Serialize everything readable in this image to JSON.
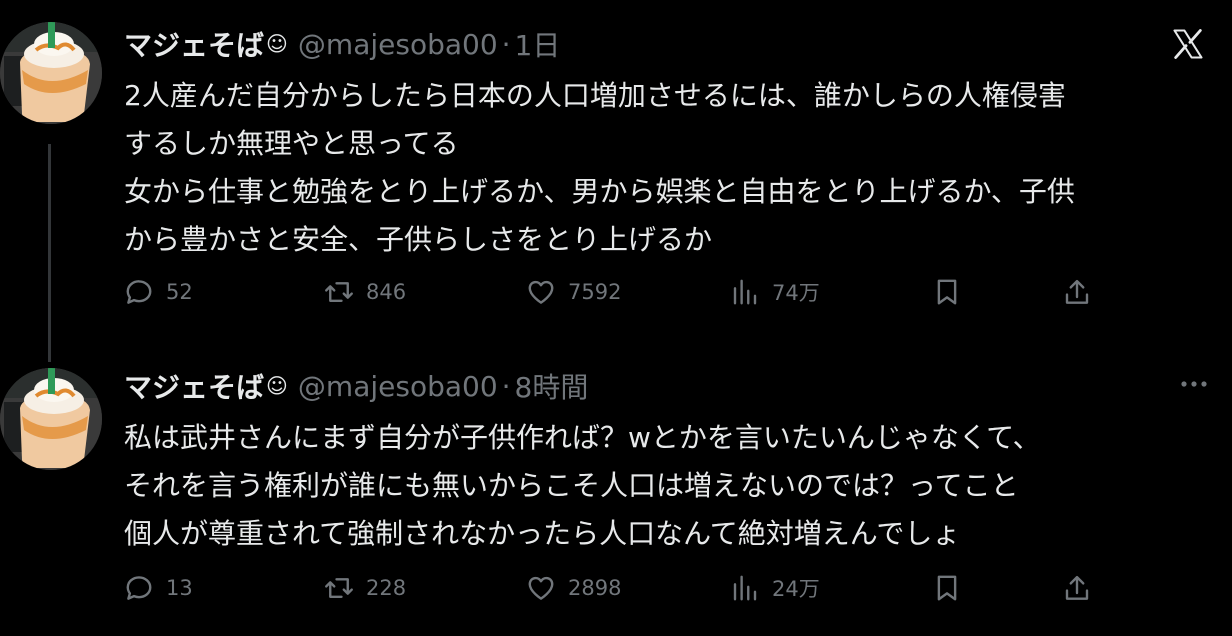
{
  "tweets": [
    {
      "author": {
        "display_name": "マジェそば",
        "emoji": "☺",
        "handle": "@majesoba00"
      },
      "separator": "·",
      "time": "1日",
      "lines": [
        "2人産んだ自分からしたら日本の人口増加させるには、誰かしらの人権侵害",
        "するしか無理やと思ってる",
        "女から仕事と勉強をとり上げるか、男から娯楽と自由をとり上げるか、子供",
        "から豊かさと安全、子供らしさをとり上げるか"
      ],
      "stats": {
        "replies": "52",
        "retweets": "846",
        "likes": "7592",
        "views": "74万"
      },
      "corner_icon": "x-logo-icon"
    },
    {
      "author": {
        "display_name": "マジェそば",
        "emoji": "☺",
        "handle": "@majesoba00"
      },
      "separator": "·",
      "time": "8時間",
      "lines": [
        "私は武井さんにまず自分が子供作れば？wとかを言いたいんじゃなくて、",
        "それを言う権利が誰にも無いからこそ人口は増えないのでは？ってこと",
        "個人が尊重されて強制されなかったら人口なんて絶対増えんでしょ"
      ],
      "stats": {
        "replies": "13",
        "retweets": "228",
        "likes": "2898",
        "views": "24万"
      },
      "corner_icon": "more-options-icon"
    }
  ],
  "colors": {
    "background": "#000000",
    "text_primary": "#e7e9ea",
    "text_secondary": "#71767b",
    "thread_line": "#333639"
  }
}
